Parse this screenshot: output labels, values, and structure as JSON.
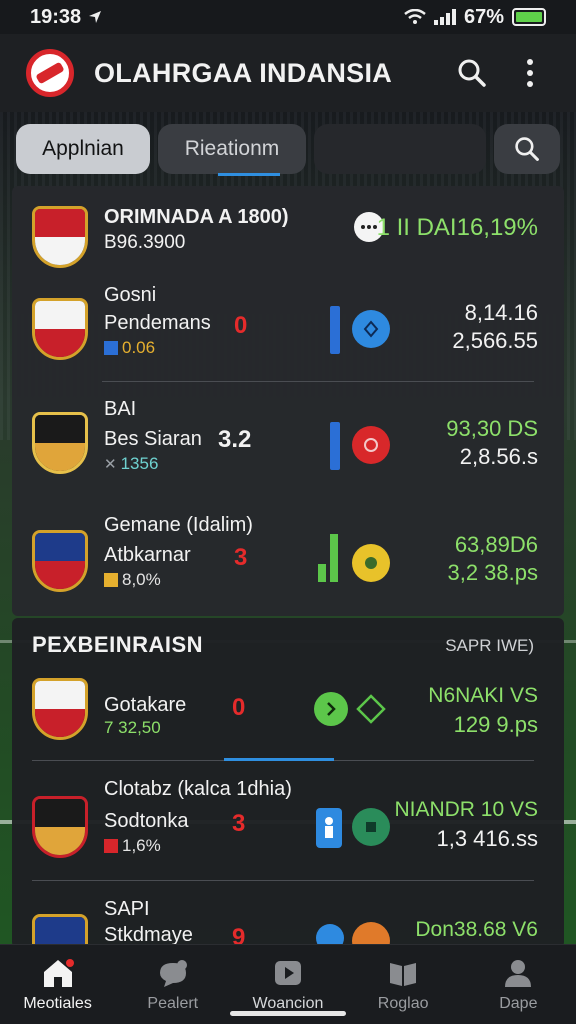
{
  "status": {
    "time": "19:38",
    "battery": "67%"
  },
  "app": {
    "title": "OLAHRGAA INDANSIA"
  },
  "tabs": [
    {
      "label": "Applnian"
    },
    {
      "label": "Rieationm"
    }
  ],
  "section1": {
    "header_title": "ORIMNADA A 1800)",
    "header_sub": "B96.3900",
    "header_odds": "1 II DAI16,19%",
    "rows": [
      {
        "line1": "Gosni",
        "line2": "Pendemans",
        "sub": "0.06",
        "score": "0",
        "odds1": "8,14.16",
        "odds2": "2,566.55"
      },
      {
        "line1": "BAI",
        "line2": "Bes Siaran",
        "sub": "1356",
        "score": "3.2",
        "odds1": "93,30 DS",
        "odds2": "2,8.56.s"
      },
      {
        "line1": "Gemane (Idalim)",
        "line2": "Atbkarnar",
        "sub": "8,0%",
        "score": "3",
        "odds1": "63,89D6",
        "odds2": "3,2 38.ps"
      }
    ]
  },
  "section2": {
    "title": "PEXBEINRAISN",
    "right": "SAPR IWE)",
    "rows": [
      {
        "line1": "",
        "line2": "Gotakare",
        "sub": "7 32,50",
        "score": "0",
        "odds1": "N6NAKI VS",
        "odds2": "129 9.ps"
      },
      {
        "line1": "Clotabz (kalca 1dhia)",
        "line2": "Sodtonka",
        "sub": "1,6%",
        "score": "3",
        "odds1": "NIANDR 10 VS",
        "odds2": "1,3 416.ss"
      },
      {
        "line1": "SAPI",
        "line2": "Stkdmaye",
        "sub": "",
        "score": "9",
        "odds1": "Don38.68 V6",
        "odds2": ""
      }
    ]
  },
  "nav": [
    {
      "label": "Meotiales",
      "icon": "home-icon"
    },
    {
      "label": "Pealert",
      "icon": "chat-icon"
    },
    {
      "label": "Woancion",
      "icon": "play-icon"
    },
    {
      "label": "Roglao",
      "icon": "book-icon"
    },
    {
      "label": "Dape",
      "icon": "person-icon"
    }
  ],
  "colors": {
    "accent_red": "#e52b2b",
    "accent_green": "#8de06a",
    "accent_blue": "#2f8fe0"
  }
}
